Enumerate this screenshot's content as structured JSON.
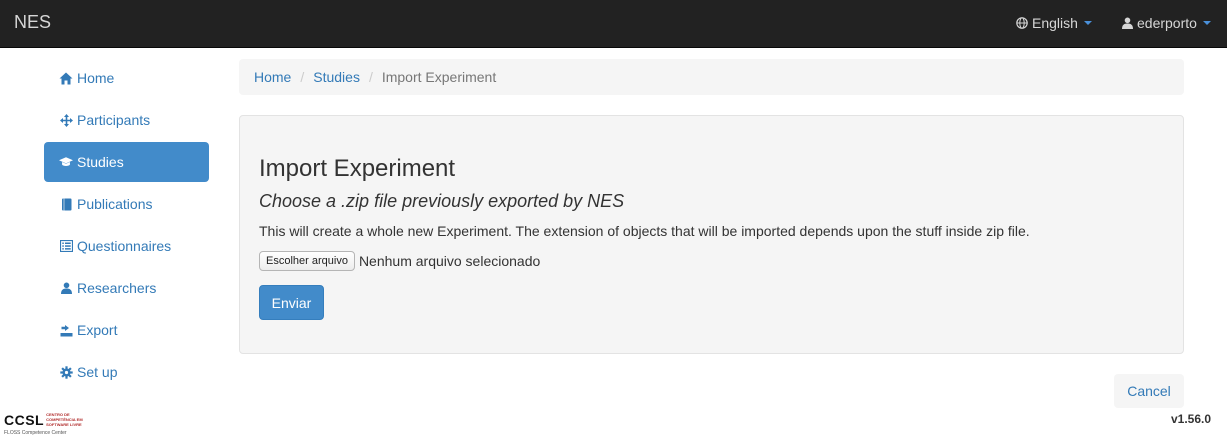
{
  "navbar": {
    "brand": "NES",
    "language": "English",
    "user": "ederporto"
  },
  "sidebar": {
    "items": [
      {
        "label": "Home",
        "icon": "home-icon"
      },
      {
        "label": "Participants",
        "icon": "move-icon"
      },
      {
        "label": "Studies",
        "icon": "graduation-cap-icon",
        "active": true
      },
      {
        "label": "Publications",
        "icon": "book-icon"
      },
      {
        "label": "Questionnaires",
        "icon": "list-alt-icon"
      },
      {
        "label": "Researchers",
        "icon": "user-icon"
      },
      {
        "label": "Export",
        "icon": "export-icon"
      },
      {
        "label": "Set up",
        "icon": "cog-icon"
      }
    ]
  },
  "breadcrumb": {
    "home": "Home",
    "studies": "Studies",
    "current": "Import Experiment"
  },
  "main": {
    "title": "Import Experiment",
    "subtitle": "Choose a .zip file previously exported by NES",
    "description": "This will create a whole new Experiment. The extension of objects that will be imported depends upon the stuff inside zip file.",
    "file_button": "Escolher arquivo",
    "file_status": "Nenhum arquivo selecionado",
    "submit": "Enviar",
    "cancel": "Cancel"
  },
  "footer": {
    "logo_text": "CCSL",
    "logo_small": "CENTRO DE COMPETÊNCIA EM SOFTWARE LIVRE",
    "logo_sub": "FLOSS Competence Center",
    "version": "v1.56.0"
  },
  "colors": {
    "navbar_bg": "#222222",
    "primary": "#428bca",
    "link": "#337ab7",
    "well_bg": "#f5f5f5"
  }
}
